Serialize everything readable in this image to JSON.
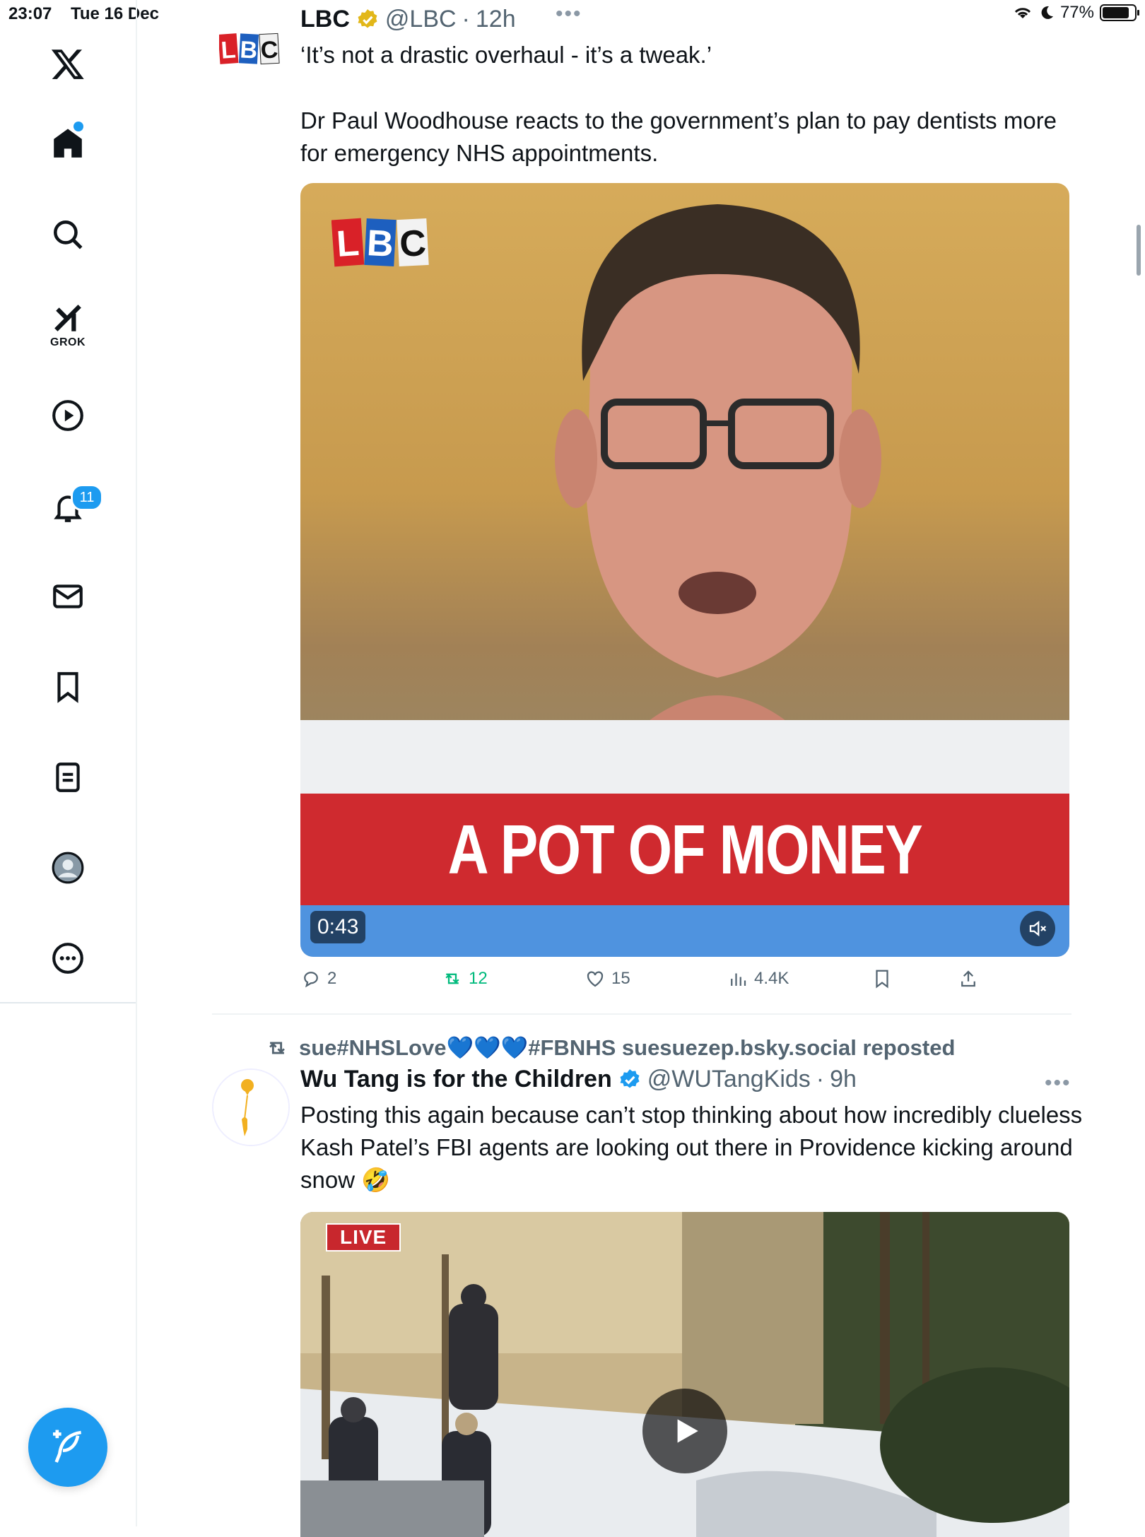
{
  "status_bar": {
    "time": "23:07",
    "date": "Tue 16 Dec",
    "battery": "77%",
    "battery_level": 0.77
  },
  "sidebar": {
    "grok_label": "GROK",
    "notifications_count": "11",
    "items": [
      "x-logo",
      "home",
      "search",
      "grok",
      "videos",
      "notifications",
      "messages",
      "bookmarks",
      "lists",
      "profile",
      "more"
    ]
  },
  "tweet1": {
    "name": "LBC",
    "handle": "@LBC",
    "separator": "·",
    "time": "12h",
    "text_line1": "‘It’s not a drastic overhaul - it’s a tweak.’",
    "text_line2": "Dr Paul Woodhouse reacts to the government’s plan to pay dentists more for emergency NHS appointments.",
    "video": {
      "banner": "A POT OF MONEY",
      "duration": "0:43",
      "logo": "LBC"
    },
    "replies": "2",
    "reposts": "12",
    "likes": "15",
    "views": "4.4K"
  },
  "tweet2": {
    "repost_by": "sue#NHSLove💙💙💙#FBNHS suesuezep.bsky.social reposted",
    "name": "Wu Tang is for the Children",
    "handle": "@WUTangKids",
    "separator": "·",
    "time": "9h",
    "text": "Posting this again because can’t stop thinking about how incredibly clueless Kash Patel’s FBI agents are looking out there in Providence kicking around snow 🤣",
    "video": {
      "live_label": "LIVE"
    }
  },
  "colors": {
    "accent": "#1d9bf0",
    "repost_green": "#00ba7c",
    "banner_red": "#cf2a2f",
    "verified_gold": "#e2b719"
  }
}
